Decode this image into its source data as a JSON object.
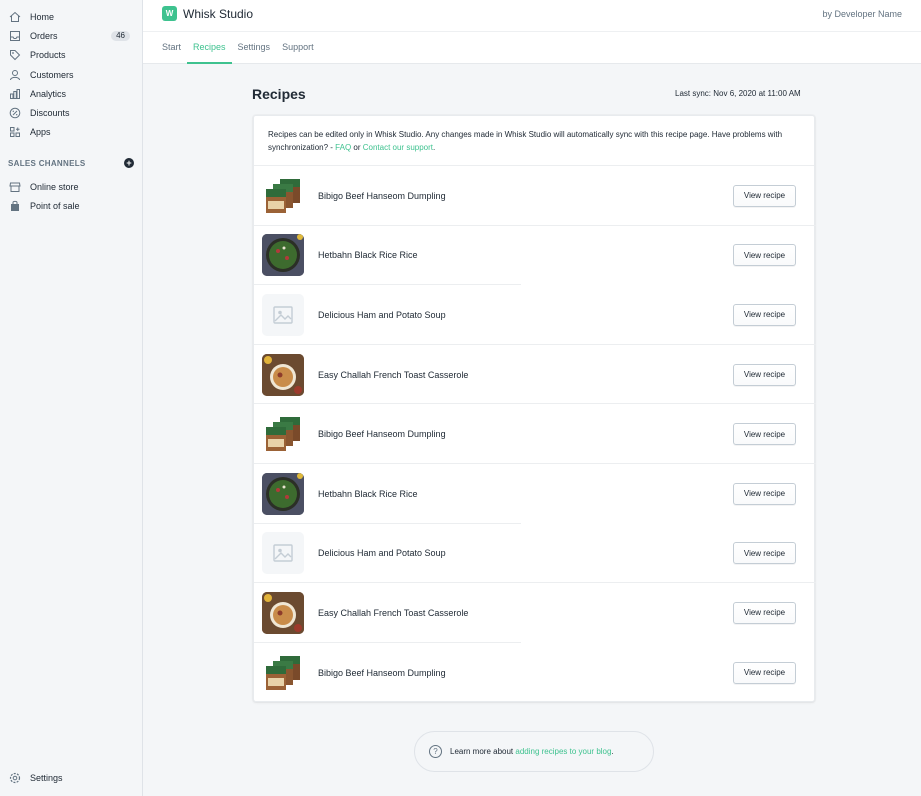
{
  "sidebar": {
    "items": [
      {
        "label": "Home",
        "icon": "home-icon"
      },
      {
        "label": "Orders",
        "icon": "orders-icon",
        "badge": "46"
      },
      {
        "label": "Products",
        "icon": "tag-icon"
      },
      {
        "label": "Customers",
        "icon": "person-icon"
      },
      {
        "label": "Analytics",
        "icon": "bar-chart-icon"
      },
      {
        "label": "Discounts",
        "icon": "discount-icon"
      },
      {
        "label": "Apps",
        "icon": "apps-icon"
      }
    ],
    "sales_channels_label": "SALES CHANNELS",
    "channels": [
      {
        "label": "Online store",
        "icon": "store-icon"
      },
      {
        "label": "Point of sale",
        "icon": "bag-icon"
      }
    ],
    "settings_label": "Settings"
  },
  "header": {
    "app_name": "Whisk Studio",
    "logo_text": "W",
    "developer": "by Developer Name",
    "tabs": [
      {
        "label": "Start",
        "active": false
      },
      {
        "label": "Recipes",
        "active": true
      },
      {
        "label": "Settings",
        "active": false
      },
      {
        "label": "Support",
        "active": false
      }
    ]
  },
  "main": {
    "title": "Recipes",
    "last_sync": "Last sync: Nov 6, 2020 at 11:00 AM",
    "notice": {
      "text_before": "Recipes can be edited only in Whisk Studio. Any changes made in Whisk Studio will automatically sync with this recipe page. Have problems with synchronization? - ",
      "faq_link": "FAQ",
      "middle": " or ",
      "support_link": "Contact our support",
      "end": "."
    },
    "view_button_label": "View recipe",
    "recipes": [
      {
        "name": "Bibigo Beef Hanseom Dumpling",
        "thumb": "pkg"
      },
      {
        "name": "Hetbahn Black Rice Rice",
        "thumb": "bowl"
      },
      {
        "name": "Delicious Ham and Potato Soup",
        "thumb": "placeholder"
      },
      {
        "name": "Easy Challah French Toast Casserole",
        "thumb": "toast"
      },
      {
        "name": "Bibigo Beef Hanseom Dumpling",
        "thumb": "pkg"
      },
      {
        "name": "Hetbahn Black Rice Rice",
        "thumb": "bowl"
      },
      {
        "name": "Delicious Ham and Potato Soup",
        "thumb": "placeholder"
      },
      {
        "name": "Easy Challah French Toast Casserole",
        "thumb": "toast"
      },
      {
        "name": "Bibigo Beef Hanseom Dumpling",
        "thumb": "pkg"
      }
    ]
  },
  "footer_help": {
    "text": "Learn more about ",
    "link": "adding recipes to your blog",
    "end": "."
  },
  "colors": {
    "accent": "#3ec28f",
    "text": "#212b36",
    "muted": "#637381",
    "background": "#f4f6f8"
  }
}
